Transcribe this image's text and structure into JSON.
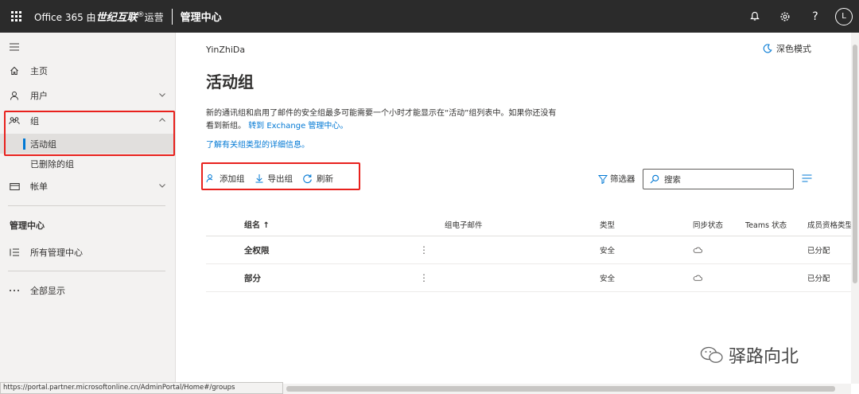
{
  "topbar": {
    "brand_prefix": "Office 365 由",
    "brand_name": "世纪互联",
    "brand_mark": "®",
    "brand_suffix": "运营",
    "admin_title": "管理中心",
    "avatar_initial": "L",
    "help_glyph": "?"
  },
  "sidebar": {
    "home": "主页",
    "users": "用户",
    "groups": "组",
    "active_groups": "活动组",
    "deleted_groups": "已删除的组",
    "billing": "帐单",
    "section_heading": "管理中心",
    "all_admin_centers": "所有管理中心",
    "show_all": "全部显示"
  },
  "main": {
    "tenant": "YinZhiDa",
    "dark_mode": "深色模式",
    "title": "活动组",
    "desc_line1": "新的通讯组和启用了邮件的安全组最多可能需要一个小时才能显示在“活动”组列表中。如果你还没有",
    "desc_line2": "看到新组。",
    "desc_link": "转到 Exchange 管理中心。",
    "learn_more": "了解有关组类型的详细信息。",
    "commands": {
      "add_group": "添加组",
      "export_groups": "导出组",
      "refresh": "刷新"
    },
    "filter": "筛选器",
    "search_placeholder": "搜索"
  },
  "table": {
    "headers": {
      "name": "组名 ↑",
      "email": "组电子邮件",
      "type": "类型",
      "sync": "同步状态",
      "teams": "Teams 状态",
      "membership": "成员资格类型"
    },
    "rows": [
      {
        "name": "全权限",
        "more": "⋮",
        "email": "",
        "type": "安全",
        "sync": "cloud",
        "teams": "",
        "membership": "已分配"
      },
      {
        "name": "部分",
        "more": "⋮",
        "email": "",
        "type": "安全",
        "sync": "cloud",
        "teams": "",
        "membership": "已分配"
      }
    ]
  },
  "status_url": "https://portal.partner.microsoftonline.cn/AdminPortal/Home#/groups",
  "watermark": "驿路向北",
  "colors": {
    "accent": "#0078d4",
    "highlight": "#e8211d",
    "topbar": "#2b2b2b",
    "sidebar_bg": "#f3f2f1"
  }
}
